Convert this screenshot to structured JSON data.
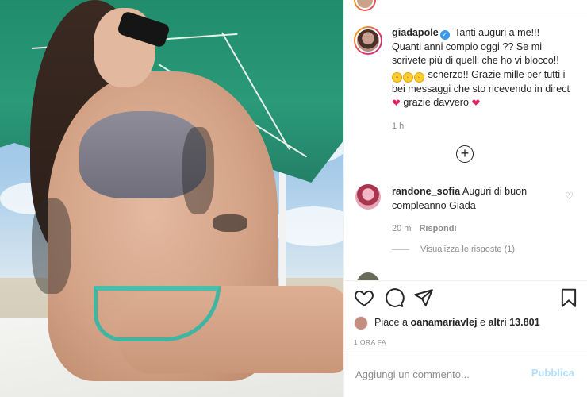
{
  "post": {
    "username": "giadapole",
    "verified": true,
    "caption_lines": [
      "Tanti auguri a me!!!",
      "Quanti anni compio oggi ?? Se mi scrivete più di quelli che ho vi blocco!!",
      "scherzo!! Grazie mille per tutti i bei messaggi che sto ricevendo in direct",
      "grazie davvero"
    ],
    "emoji": [
      "😅",
      "😅",
      "🤣"
    ],
    "heart": "❤",
    "caption_time": "1 h",
    "load_more_symbol": "+"
  },
  "comments": [
    {
      "username": "randone_sofia",
      "text": "Auguri di buon compleanno Giada",
      "time": "20 m",
      "reply_label": "Rispondi",
      "like_icon": "♡"
    }
  ],
  "view_replies_label": "Visualizza le risposte (1)",
  "actions": {
    "like": "heart-outline-icon",
    "comment": "comment-bubble-icon",
    "share": "paper-plane-icon",
    "save": "bookmark-icon"
  },
  "likes": {
    "prefix": "Piace a",
    "user": "oanamariavlej",
    "middle": "e",
    "others": "altri 13.801"
  },
  "post_time": "1 ORA FA",
  "add_comment": {
    "placeholder": "Aggiungi un commento...",
    "publish_label": "Pubblica"
  },
  "colors": {
    "accent": "#0095f6",
    "publish_disabled": "#b2dffc",
    "heart": "#e0245e",
    "muted_text": "#8e8e8e"
  }
}
